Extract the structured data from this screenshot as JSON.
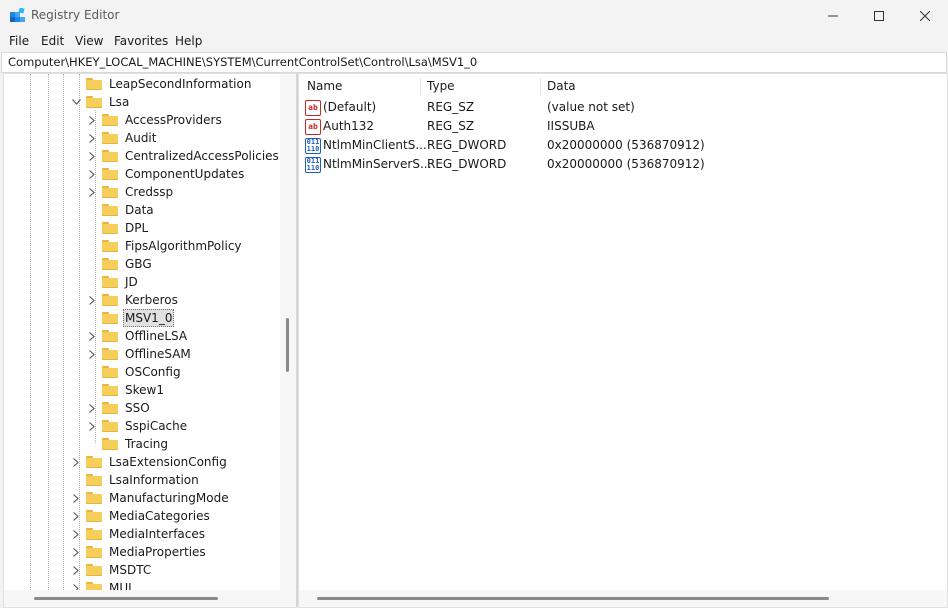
{
  "window": {
    "title": "Registry Editor",
    "controls": {
      "minimize_icon": "minimize-icon",
      "maximize_icon": "maximize-icon",
      "close_icon": "close-icon"
    }
  },
  "menu": [
    "File",
    "Edit",
    "View",
    "Favorites",
    "Help"
  ],
  "address": "Computer\\HKEY_LOCAL_MACHINE\\SYSTEM\\CurrentControlSet\\Control\\Lsa\\MSV1_0",
  "tree": [
    {
      "label": "LeapSecondInformation",
      "level": 0,
      "expander": "none"
    },
    {
      "label": "Lsa",
      "level": 0,
      "expander": "expanded"
    },
    {
      "label": "AccessProviders",
      "level": 1,
      "expander": "collapsed"
    },
    {
      "label": "Audit",
      "level": 1,
      "expander": "collapsed"
    },
    {
      "label": "CentralizedAccessPolicies",
      "level": 1,
      "expander": "collapsed"
    },
    {
      "label": "ComponentUpdates",
      "level": 1,
      "expander": "collapsed"
    },
    {
      "label": "Credssp",
      "level": 1,
      "expander": "collapsed"
    },
    {
      "label": "Data",
      "level": 1,
      "expander": "none"
    },
    {
      "label": "DPL",
      "level": 1,
      "expander": "none"
    },
    {
      "label": "FipsAlgorithmPolicy",
      "level": 1,
      "expander": "none"
    },
    {
      "label": "GBG",
      "level": 1,
      "expander": "none"
    },
    {
      "label": "JD",
      "level": 1,
      "expander": "none"
    },
    {
      "label": "Kerberos",
      "level": 1,
      "expander": "collapsed"
    },
    {
      "label": "MSV1_0",
      "level": 1,
      "expander": "none",
      "selected": true
    },
    {
      "label": "OfflineLSA",
      "level": 1,
      "expander": "collapsed"
    },
    {
      "label": "OfflineSAM",
      "level": 1,
      "expander": "collapsed"
    },
    {
      "label": "OSConfig",
      "level": 1,
      "expander": "none"
    },
    {
      "label": "Skew1",
      "level": 1,
      "expander": "none"
    },
    {
      "label": "SSO",
      "level": 1,
      "expander": "collapsed"
    },
    {
      "label": "SspiCache",
      "level": 1,
      "expander": "collapsed"
    },
    {
      "label": "Tracing",
      "level": 1,
      "expander": "none"
    },
    {
      "label": "LsaExtensionConfig",
      "level": 0,
      "expander": "collapsed"
    },
    {
      "label": "LsaInformation",
      "level": 0,
      "expander": "none"
    },
    {
      "label": "ManufacturingMode",
      "level": 0,
      "expander": "collapsed"
    },
    {
      "label": "MediaCategories",
      "level": 0,
      "expander": "collapsed"
    },
    {
      "label": "MediaInterfaces",
      "level": 0,
      "expander": "collapsed"
    },
    {
      "label": "MediaProperties",
      "level": 0,
      "expander": "collapsed"
    },
    {
      "label": "MSDTC",
      "level": 0,
      "expander": "collapsed"
    },
    {
      "label": "MUI",
      "level": 0,
      "expander": "collapsed"
    }
  ],
  "list": {
    "columns": [
      "Name",
      "Type",
      "Data"
    ],
    "rows": [
      {
        "icon": "string-value-icon",
        "icon_text": "ab",
        "name": "(Default)",
        "type": "REG_SZ",
        "data": "(value not set)"
      },
      {
        "icon": "string-value-icon",
        "icon_text": "ab",
        "name": "Auth132",
        "type": "REG_SZ",
        "data": "IISSUBA"
      },
      {
        "icon": "dword-value-icon",
        "icon_text": "011\n110",
        "name": "NtlmMinClientS...",
        "type": "REG_DWORD",
        "data": "0x20000000 (536870912)"
      },
      {
        "icon": "dword-value-icon",
        "icon_text": "011\n110",
        "name": "NtlmMinServerS...",
        "type": "REG_DWORD",
        "data": "0x20000000 (536870912)"
      }
    ]
  },
  "colors": {
    "folder": "#f6cf5b",
    "string_icon": "#c62828",
    "dword_icon": "#1f5fb4",
    "selection": "#e1e1e1"
  }
}
